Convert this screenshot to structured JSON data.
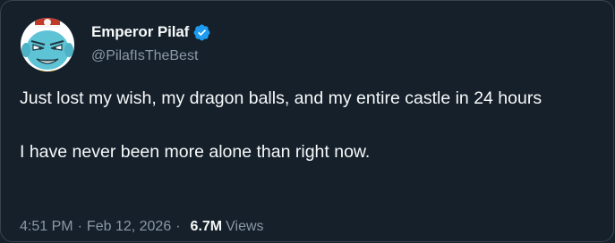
{
  "author": {
    "display_name": "Emperor Pilaf",
    "handle": "@PilafIsTheBest",
    "verified": true,
    "avatar_icon": "pilaf-avatar-icon",
    "verified_icon": "verified-badge-icon"
  },
  "tweet": {
    "paragraphs": [
      "Just lost my wish, my dragon balls, and my entire castle in 24 hours",
      "I have never been more alone than right now."
    ]
  },
  "meta": {
    "time": "4:51 PM",
    "separator": "·",
    "date": "Feb 12, 2026",
    "views_count": "6.7M",
    "views_label": "Views"
  },
  "colors": {
    "background": "#15202b",
    "border": "#38444d",
    "text_primary": "#f7f9f9",
    "text_secondary": "#8b98a5",
    "verified_blue": "#1d9bf0",
    "avatar_skin": "#5fc3d6"
  }
}
